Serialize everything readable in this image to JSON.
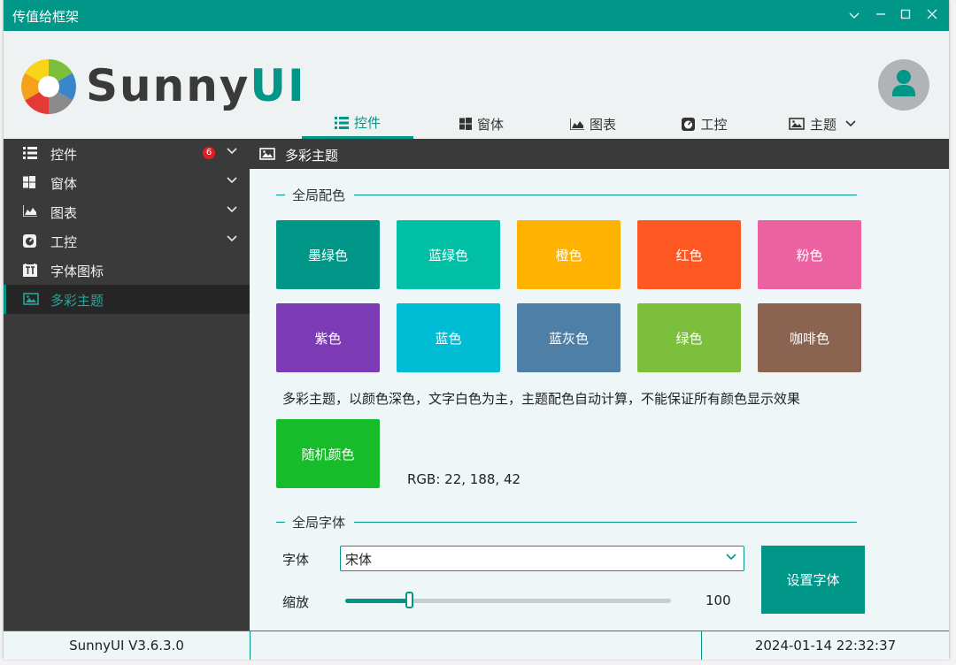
{
  "window": {
    "title": "传值给框架"
  },
  "brand": {
    "part1": "Sunny",
    "part2": "UI"
  },
  "topnav": [
    {
      "label": "控件",
      "icon": "list-icon",
      "active": true
    },
    {
      "label": "窗体",
      "icon": "windows-icon"
    },
    {
      "label": "图表",
      "icon": "area-chart-icon"
    },
    {
      "label": "工控",
      "icon": "gauge-icon"
    },
    {
      "label": "主题",
      "icon": "image-icon",
      "dropdown": true
    }
  ],
  "sidebar": {
    "items": [
      {
        "label": "控件",
        "icon": "list-icon",
        "badge": "6",
        "expandable": true
      },
      {
        "label": "窗体",
        "icon": "windows-icon",
        "expandable": true
      },
      {
        "label": "图表",
        "icon": "area-chart-icon",
        "expandable": true
      },
      {
        "label": "工控",
        "icon": "gauge-icon",
        "expandable": true
      },
      {
        "label": "字体图标",
        "icon": "font-icon"
      },
      {
        "label": "多彩主题",
        "icon": "image-icon",
        "active": true
      }
    ]
  },
  "page": {
    "title": "多彩主题"
  },
  "colors": {
    "group_title": "全局配色",
    "buttons": [
      {
        "label": "墨绿色",
        "color": "#009688"
      },
      {
        "label": "蓝绿色",
        "color": "#00BFA5"
      },
      {
        "label": "橙色",
        "color": "#FFB300"
      },
      {
        "label": "红色",
        "color": "#FF5722"
      },
      {
        "label": "粉色",
        "color": "#EC62A1"
      },
      {
        "label": "紫色",
        "color": "#7E3BB6"
      },
      {
        "label": "蓝色",
        "color": "#00BCD4"
      },
      {
        "label": "蓝灰色",
        "color": "#4E7FA6"
      },
      {
        "label": "绿色",
        "color": "#7CBF3C"
      },
      {
        "label": "咖啡色",
        "color": "#8B6451"
      }
    ],
    "description": "多彩主题，以颜色深色，文字白色为主，主题配色自动计算，不能保证所有颜色显示效果",
    "random_label": "随机颜色",
    "random_color": "#16BC2A",
    "rgb_text": "RGB: 22, 188, 42"
  },
  "fonts": {
    "group_title": "全局字体",
    "font_label": "字体",
    "font_value": "宋体",
    "zoom_label": "缩放",
    "zoom_value": "100",
    "zoom_fraction": 0.197,
    "set_font_label": "设置字体"
  },
  "statusbar": {
    "version": "SunnyUI V3.6.3.0",
    "middle": "",
    "datetime": "2024-01-14 22:32:37"
  },
  "theme": {
    "accent": "#009688",
    "sidebar_bg": "#3A3A3A"
  }
}
